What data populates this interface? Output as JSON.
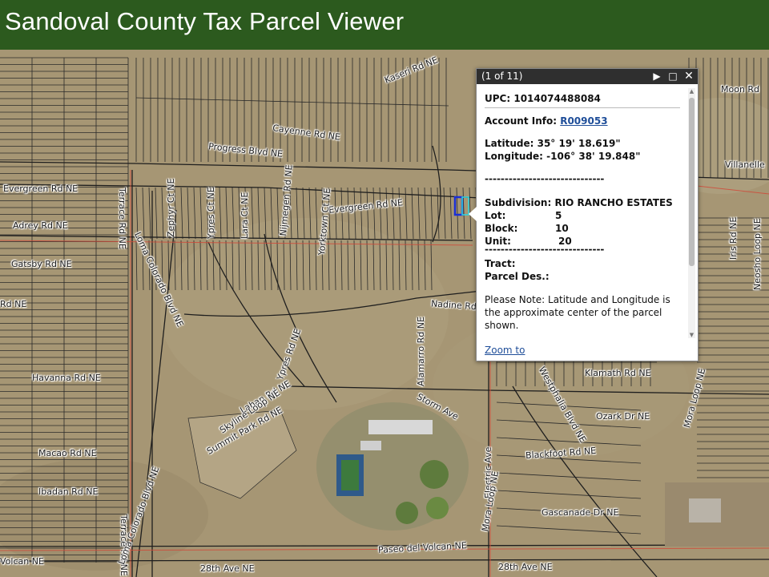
{
  "header": {
    "title": "Sandoval County Tax Parcel Viewer"
  },
  "map": {
    "labels": [
      {
        "key": "kaseri",
        "text": "Kaseri Rd NE"
      },
      {
        "key": "cayenne",
        "text": "Cayenne Rd NE"
      },
      {
        "key": "progress",
        "text": "Progress Blvd NE"
      },
      {
        "key": "evergreen_w",
        "text": "Evergreen Rd NE"
      },
      {
        "key": "evergreen_e",
        "text": "Evergreen Rd NE"
      },
      {
        "key": "adrey",
        "text": "Adrey Rd NE"
      },
      {
        "key": "gatsby",
        "text": "Gatsby Rd NE"
      },
      {
        "key": "nadine",
        "text": "Nadine Rd NE"
      },
      {
        "key": "havanna",
        "text": "Havanna Rd NE"
      },
      {
        "key": "macao",
        "text": "Macao Rd NE"
      },
      {
        "key": "ibadan",
        "text": "Ibadan Rd NE"
      },
      {
        "key": "laban",
        "text": "Laban Rd NE"
      },
      {
        "key": "skyline",
        "text": "Skyline Loop NE"
      },
      {
        "key": "summit",
        "text": "Summit Park Rd NE"
      },
      {
        "key": "storm",
        "text": "Storm Ave"
      },
      {
        "key": "klamath",
        "text": "Klamath Rd NE"
      },
      {
        "key": "ozark",
        "text": "Ozark Dr NE"
      },
      {
        "key": "blackfoot",
        "text": "Blackfoot Rd NE"
      },
      {
        "key": "gascanade",
        "text": "Gascanade Dr NE"
      },
      {
        "key": "paseo",
        "text": "Paseo del Volcan NE"
      },
      {
        "key": "volcan",
        "text": "Volcan NE"
      },
      {
        "key": "ave28_w",
        "text": "28th Ave NE"
      },
      {
        "key": "ave28_e",
        "text": "28th Ave NE"
      },
      {
        "key": "villanelle",
        "text": "Villanelle"
      },
      {
        "key": "moon",
        "text": "Moon Rd"
      },
      {
        "key": "terrace",
        "text": "Terrace Rd NE"
      },
      {
        "key": "terrace2",
        "text": "Terrace Rd NE"
      },
      {
        "key": "zephyr",
        "text": "Zephyr Ct NE"
      },
      {
        "key": "ypres_ct",
        "text": "Ypres Ct NE"
      },
      {
        "key": "lara",
        "text": "Lara Ct NE"
      },
      {
        "key": "nijmegen",
        "text": "Nijmegen Rd NE"
      },
      {
        "key": "yorktown",
        "text": "Yorktown Ct NE"
      },
      {
        "key": "ypres_rd",
        "text": "Ypres Rd NE"
      },
      {
        "key": "alamarro",
        "text": "Alamarro Rd NE"
      },
      {
        "key": "electric",
        "text": "Electric Ave"
      },
      {
        "key": "mora_w",
        "text": "Mora Loop NE"
      },
      {
        "key": "westphalia",
        "text": "Westphalia Blvd NE"
      },
      {
        "key": "mora_e",
        "text": "Mora Loop NE"
      },
      {
        "key": "iris",
        "text": "Iris Rd NE"
      },
      {
        "key": "neosho",
        "text": "Neosho Loop NE"
      },
      {
        "key": "loma1",
        "text": "Loma Colorado Blvd NE"
      },
      {
        "key": "loma2",
        "text": "Loma Colorado Blvd NE"
      },
      {
        "key": "rd_ne",
        "text": "Rd NE"
      }
    ]
  },
  "popup": {
    "count": "(1 of 11)",
    "upc_label": "UPC:",
    "upc_value": "1014074488084",
    "account_label": "Account Info:",
    "account_value": "R009053",
    "lat_label": "Latitude:",
    "lat_value": "35° 19' 18.619\"",
    "lon_label": "Longitude:",
    "lon_value": "-106° 38' 19.848\"",
    "dashes": "------------------------------",
    "subdivision_label": "Subdivision:",
    "subdivision_value": "RIO RANCHO ESTATES",
    "lot_label": "Lot:",
    "lot_value": "5",
    "block_label": "Block:",
    "block_value": "10",
    "unit_label": "Unit:",
    "unit_value": "20",
    "tract_label": "Tract:",
    "parcel_label": "Parcel Des.:",
    "note": "Please Note: Latitude and Longitude is the approximate center of the parcel shown.",
    "zoom_label": "Zoom to"
  },
  "colors": {
    "header_bg": "#2c5a1e",
    "parcel_line": "#2a2a2a",
    "highlight": "#1a2fd6",
    "boundary": "#d04a3a"
  }
}
